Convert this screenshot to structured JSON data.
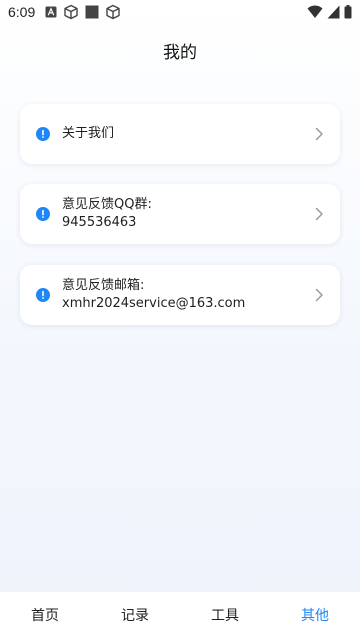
{
  "status_bar": {
    "time": "6:09",
    "left_icons": [
      "font-a-icon",
      "cube-icon",
      "square-icon",
      "cube-icon"
    ],
    "right_icons": [
      "wifi-icon",
      "signal-icon",
      "battery-icon"
    ]
  },
  "header": {
    "title": "我的"
  },
  "cards": [
    {
      "icon": "info-icon",
      "label": "关于我们",
      "value": ""
    },
    {
      "icon": "info-icon",
      "label": "意见反馈QQ群:",
      "value": "945536463"
    },
    {
      "icon": "info-icon",
      "label": "意见反馈邮箱:",
      "value": "xmhr2024service@163.com"
    }
  ],
  "bottom_nav": {
    "items": [
      {
        "label": "首页",
        "active": false
      },
      {
        "label": "记录",
        "active": false
      },
      {
        "label": "工具",
        "active": false
      },
      {
        "label": "其他",
        "active": true
      }
    ],
    "active_color": "#1f87f5"
  },
  "colors": {
    "accent": "#1f87f5",
    "info_icon": "#1f87f5"
  }
}
